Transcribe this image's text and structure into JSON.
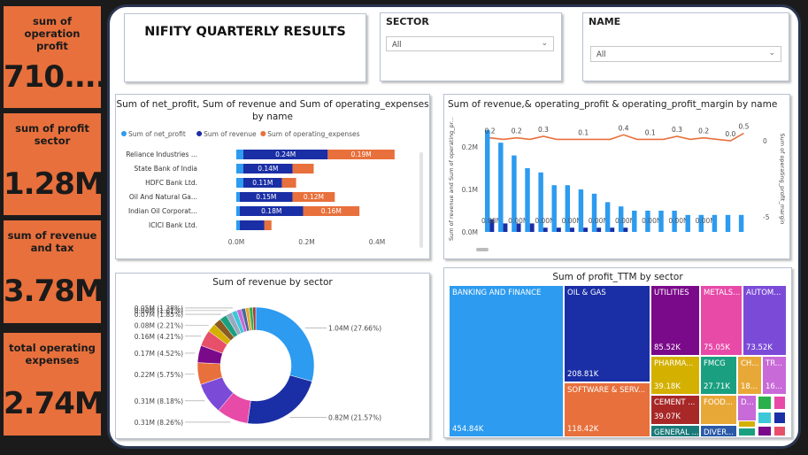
{
  "kpis": [
    {
      "label": "sum of operation profit",
      "value": "710...."
    },
    {
      "label": "sum of profit sector",
      "value": "1.28M"
    },
    {
      "label": "sum of revenue and tax",
      "value": "3.78M"
    },
    {
      "label": "total operating expenses",
      "value": "2.74M"
    }
  ],
  "header": {
    "title": "NIFITY QUARTERLY RESULTS"
  },
  "slicers": {
    "sector": {
      "title": "SECTOR",
      "value": "All"
    },
    "name": {
      "title": "NAME",
      "value": "All"
    }
  },
  "colors": {
    "net_profit": "#2c9bf0",
    "revenue": "#1a2ea5",
    "operating_expenses": "#e8703c",
    "line": "#e8703c",
    "accent": "#e8703c"
  },
  "chart_data": [
    {
      "type": "bar",
      "orientation": "horizontal",
      "stacked": true,
      "title": "Sum of net_profit, Sum of revenue and Sum of operating_expenses by name",
      "legend": [
        "Sum of net_profit",
        "Sum of revenue",
        "Sum of operating_expenses"
      ],
      "categories": [
        "Reliance Industries ...",
        "State Bank of India",
        "HDFC Bank Ltd.",
        "Oil And Natural Ga...",
        "Indian Oil Corporat...",
        "ICICI Bank Ltd."
      ],
      "series": [
        {
          "name": "Sum of net_profit",
          "values": [
            0.02,
            0.02,
            0.02,
            0.01,
            0.01,
            0.01
          ]
        },
        {
          "name": "Sum of revenue",
          "values": [
            0.24,
            0.14,
            0.11,
            0.15,
            0.18,
            0.07
          ]
        },
        {
          "name": "Sum of operating_expenses",
          "values": [
            0.19,
            0.06,
            0.04,
            0.12,
            0.16,
            0.02
          ]
        }
      ],
      "data_labels": [
        [
          "",
          "0.24M",
          "0.19M"
        ],
        [
          "",
          "0.14M",
          ""
        ],
        [
          "",
          "0.11M",
          ""
        ],
        [
          "",
          "0.15M",
          "0.12M"
        ],
        [
          "",
          "0.18M",
          "0.16M"
        ],
        [
          "",
          "",
          ""
        ]
      ],
      "x_ticks": [
        "0.0M",
        "0.2M",
        "0.4M"
      ],
      "xlim": [
        0,
        0.4
      ]
    },
    {
      "type": "bar+line",
      "title": "Sum of revenue,& operating_profit &  operating_profit_margin by name",
      "ylabel_left": "Sum of revenue and Sum of operating_pr...",
      "ylabel_right": "Sum of operating_profit_margin",
      "y_ticks_left": [
        "0.0M",
        "0.1M",
        "0.2M"
      ],
      "y_ticks_right": [
        "-5",
        "0"
      ],
      "ylim_left": [
        0,
        0.25
      ],
      "ylim_right": [
        -6,
        1
      ],
      "bars": [
        {
          "revenue": 0.24,
          "profit": 0.03
        },
        {
          "revenue": 0.21,
          "profit": 0.02
        },
        {
          "revenue": 0.18,
          "profit": 0.02
        },
        {
          "revenue": 0.15,
          "profit": 0.02
        },
        {
          "revenue": 0.14,
          "profit": 0.01
        },
        {
          "revenue": 0.11,
          "profit": 0.01
        },
        {
          "revenue": 0.11,
          "profit": 0.01
        },
        {
          "revenue": 0.1,
          "profit": 0.01
        },
        {
          "revenue": 0.09,
          "profit": 0.01
        },
        {
          "revenue": 0.07,
          "profit": 0.01
        },
        {
          "revenue": 0.06,
          "profit": 0.01
        },
        {
          "revenue": 0.05,
          "profit": 0.0
        },
        {
          "revenue": 0.05,
          "profit": 0.0
        },
        {
          "revenue": 0.05,
          "profit": 0.0
        },
        {
          "revenue": 0.05,
          "profit": 0.0
        },
        {
          "revenue": 0.04,
          "profit": 0.0
        },
        {
          "revenue": 0.04,
          "profit": 0.0
        },
        {
          "revenue": 0.04,
          "profit": 0.0
        },
        {
          "revenue": 0.04,
          "profit": 0.0
        },
        {
          "revenue": 0.04,
          "profit": 0.0
        }
      ],
      "bar_labels": [
        "0.00M",
        "",
        "0.00M",
        "",
        "0.00M",
        "",
        "0.00M",
        "",
        "0.00M",
        "",
        "0.00M",
        "",
        "0.00M",
        "",
        "0.00M",
        "",
        "0.00M",
        "",
        "",
        ""
      ],
      "line": [
        0.2,
        0.1,
        0.2,
        0.1,
        0.3,
        0.1,
        0.1,
        0.1,
        0.1,
        0.1,
        0.4,
        0.1,
        0.1,
        0.1,
        0.3,
        0.1,
        0.2,
        0.1,
        0.0,
        0.5
      ],
      "line_labels": [
        "0.2",
        "",
        "0.2",
        "",
        "0.3",
        "",
        "",
        "0.1",
        "",
        "",
        "0.4",
        "",
        "0.1",
        "",
        "0.3",
        "",
        "0.2",
        "",
        "0.0",
        "0.5"
      ]
    },
    {
      "type": "pie",
      "donut": true,
      "title": "Sum of revenue by sector",
      "slices": [
        {
          "label": "1.04M (27.66%)",
          "value": 27.66,
          "color": "#2c9bf0"
        },
        {
          "label": "0.82M (21.57%)",
          "value": 21.57,
          "color": "#1a2ea5"
        },
        {
          "label": "0.31M (8.26%)",
          "value": 8.26,
          "color": "#e84aa8"
        },
        {
          "label": "0.31M (8.18%)",
          "value": 8.18,
          "color": "#7b4bd8"
        },
        {
          "label": "0.22M (5.75%)",
          "value": 5.75,
          "color": "#e8703c"
        },
        {
          "label": "0.17M (4.52%)",
          "value": 4.52,
          "color": "#7a0a8a"
        },
        {
          "label": "0.16M (4.21%)",
          "value": 4.21,
          "color": "#e8506a"
        },
        {
          "label": "0.08M (2.21%)",
          "value": 2.21,
          "color": "#d4b000"
        },
        {
          "label": "",
          "value": 2.0,
          "color": "#8a5a20"
        },
        {
          "label": "0.07M (1.85%)",
          "value": 1.85,
          "color": "#1aa080"
        },
        {
          "label": "0.06M (1.61%)",
          "value": 1.61,
          "color": "#9aa8c0"
        },
        {
          "label": "0.05M (1.38%)",
          "value": 1.38,
          "color": "#3cc8d8"
        },
        {
          "label": "",
          "value": 1.2,
          "color": "#c86ad8"
        },
        {
          "label": "",
          "value": 1.1,
          "color": "#4a6a9a"
        },
        {
          "label": "",
          "value": 1.0,
          "color": "#e8a838"
        },
        {
          "label": "",
          "value": 0.9,
          "color": "#2ab04a"
        },
        {
          "label": "",
          "value": 0.8,
          "color": "#a83a3a"
        }
      ]
    },
    {
      "type": "treemap",
      "title": "Sum of profit_TTM by sector",
      "items": [
        {
          "name": "BANKING AND FINANCE",
          "value": "454.84K",
          "color": "#2c9bf0"
        },
        {
          "name": "OIL & GAS",
          "value": "208.81K",
          "color": "#1a2ea5"
        },
        {
          "name": "SOFTWARE & SERV...",
          "value": "118.42K",
          "color": "#e8703c"
        },
        {
          "name": "UTILITIES",
          "value": "85.52K",
          "color": "#7a0a8a"
        },
        {
          "name": "METALS...",
          "value": "75.05K",
          "color": "#e84aa8"
        },
        {
          "name": "AUTOM...",
          "value": "73.52K",
          "color": "#7b4bd8"
        },
        {
          "name": "PHARMA...",
          "value": "39.18K",
          "color": "#d4b000"
        },
        {
          "name": "FMCG",
          "value": "27.71K",
          "color": "#1aa080"
        },
        {
          "name": "CH...",
          "value": "18...",
          "color": "#e8a838"
        },
        {
          "name": "TR...",
          "value": "16...",
          "color": "#c86ad8"
        },
        {
          "name": "CEMENT ...",
          "value": "39.07K",
          "color": "#a82828"
        },
        {
          "name": "FOOD...",
          "value": "",
          "color": "#e8a838"
        },
        {
          "name": "D...",
          "value": "",
          "color": "#c86ad8"
        },
        {
          "name": "GENERAL ...",
          "value": "",
          "color": "#1a7a7a"
        },
        {
          "name": "DIVER...",
          "value": "",
          "color": "#2a5aa8"
        }
      ]
    }
  ]
}
